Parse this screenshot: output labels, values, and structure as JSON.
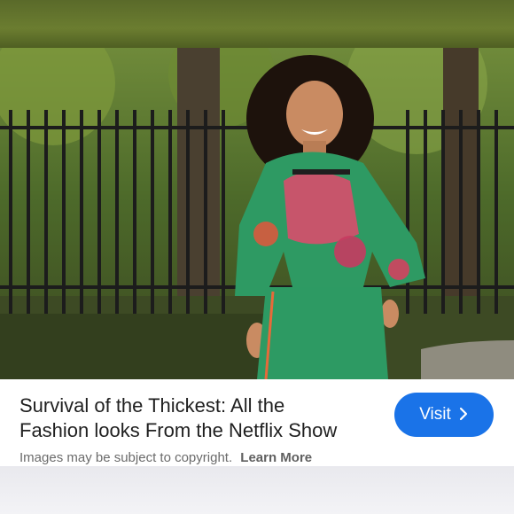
{
  "result": {
    "title_line1": "Survival of the Thickest: All the",
    "title_line2": "Fashion looks From the Netflix Show",
    "copyright_text": "Images may be subject to copyright.",
    "learn_more": "Learn More",
    "visit_label": "Visit",
    "visit_icon": "chevron-right-icon"
  },
  "colors": {
    "accent": "#1a73e8",
    "card_bg": "#ffffff"
  }
}
